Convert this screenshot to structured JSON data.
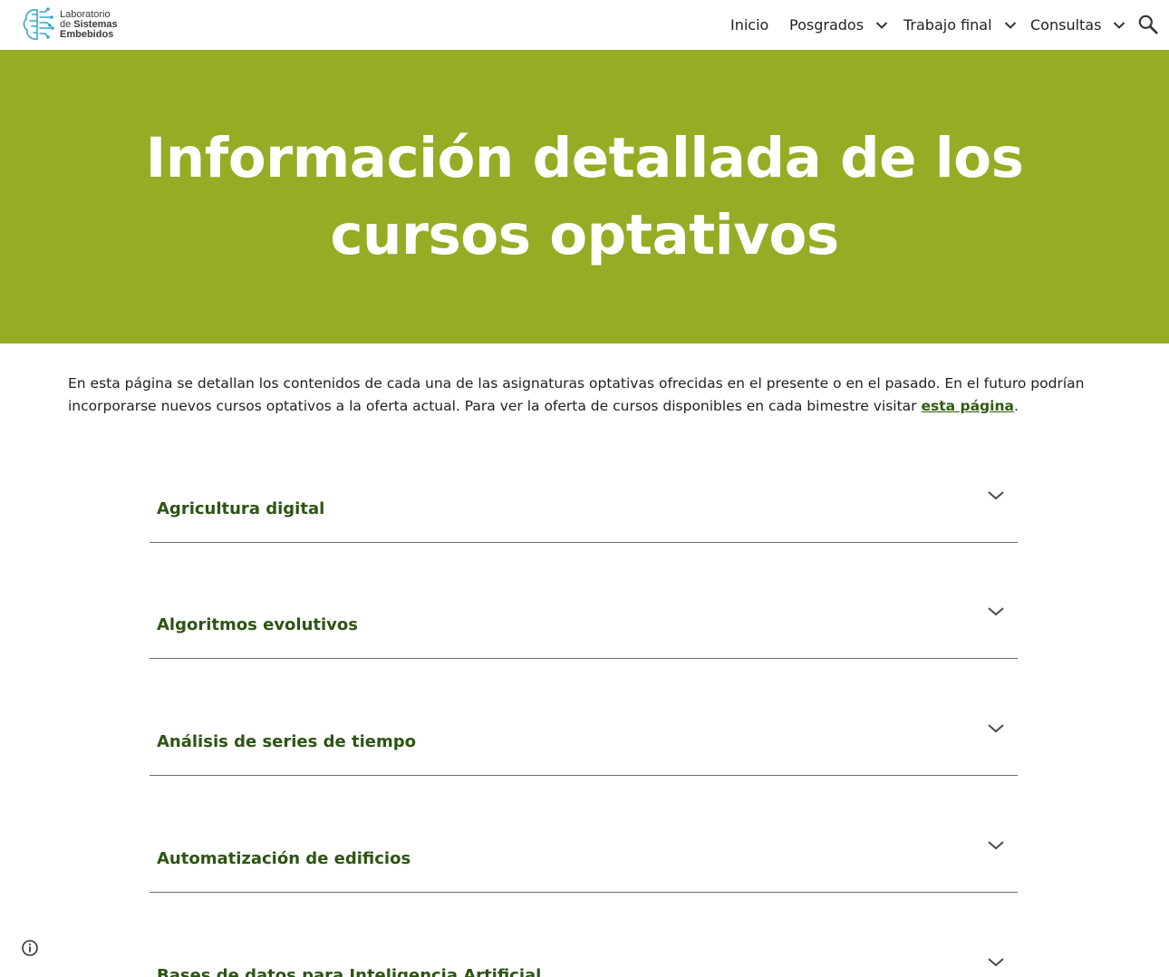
{
  "header": {
    "logo": {
      "line1": "Laboratorio",
      "line2_prefix": "de ",
      "line2_bold": "Sistemas",
      "line3": "Embebidos",
      "icon": "brain-circuit-icon",
      "color": "#3aa6c8"
    },
    "nav": [
      {
        "label": "Inicio",
        "has_dropdown": false
      },
      {
        "label": "Posgrados",
        "has_dropdown": true
      },
      {
        "label": "Trabajo final",
        "has_dropdown": true
      },
      {
        "label": "Consultas",
        "has_dropdown": true
      }
    ],
    "search_icon": "search-icon"
  },
  "banner": {
    "title": "Información detallada de los cursos optativos",
    "background": "#95ac24"
  },
  "intro": {
    "text": "En esta página se detallan los contenidos de cada una de las asignaturas optativas ofrecidas en el presente o en el pasado. En el futuro podrían incorporarse nuevos cursos optativos a la oferta actual. Para ver la oferta de cursos disponibles en cada bimestre visitar ",
    "link": "esta página",
    "after": "."
  },
  "courses": [
    {
      "title": "Agricultura digital"
    },
    {
      "title": "Algoritmos evolutivos"
    },
    {
      "title": "Análisis de series de tiempo"
    },
    {
      "title": "Automatización de edificios"
    },
    {
      "title": "Bases de datos para Inteligencia Artificial"
    }
  ],
  "footer": {
    "info_icon": "info-icon"
  },
  "colors": {
    "accent": "#95ac24",
    "heading_green": "#2d5414",
    "link_green": "#2f5c0f"
  }
}
